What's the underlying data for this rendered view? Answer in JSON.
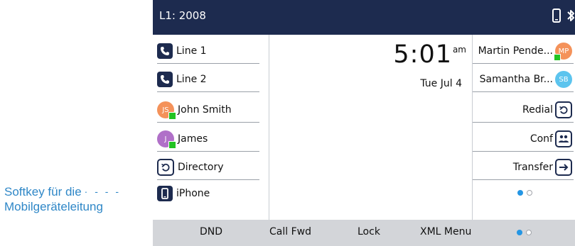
{
  "callout": {
    "line1": "Softkey für die",
    "line2": "Mobilgeräteleitung"
  },
  "header": {
    "title": "L1: 2008"
  },
  "clock": {
    "time": "5:01",
    "ampm": "am",
    "date": "Tue Jul 4"
  },
  "left_keys": [
    {
      "label": "Line 1",
      "icon": "phone-icon"
    },
    {
      "label": "Line 2",
      "icon": "phone-icon"
    },
    {
      "label": "John Smith",
      "avatar": "JS",
      "avatar_color": "#f4925a"
    },
    {
      "label": "James",
      "avatar": "J",
      "avatar_color": "#b070c8"
    },
    {
      "label": "Directory",
      "icon": "directory-icon"
    },
    {
      "label": "iPhone",
      "icon": "mobile-icon"
    }
  ],
  "right_keys": [
    {
      "label": "Martin Pende...",
      "avatar": "MP",
      "avatar_color": "#f4925a"
    },
    {
      "label": "Samantha Br...",
      "avatar": "SB",
      "avatar_color": "#5cc4ee"
    },
    {
      "label": "Redial",
      "icon": "redial-icon"
    },
    {
      "label": "Conf",
      "icon": "conference-icon"
    },
    {
      "label": "Transfer",
      "icon": "transfer-icon"
    }
  ],
  "softkeys": [
    "DND",
    "Call Fwd",
    "Lock",
    "XML Menu"
  ],
  "colors": {
    "header_bg": "#1d2b4f",
    "accent_dot": "#2496e4",
    "presence": "#22c322",
    "softkey_bg": "#d3d5d9",
    "callout": "#2f87c7"
  }
}
